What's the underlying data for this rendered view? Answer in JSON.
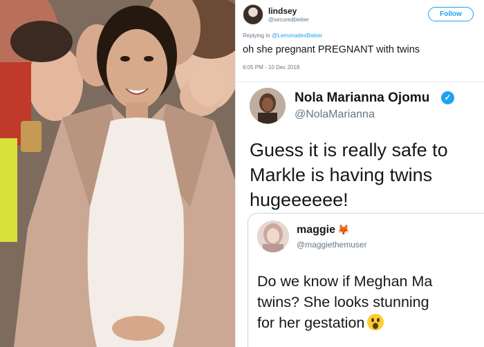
{
  "colors": {
    "twitter_blue": "#1da1f2",
    "text": "#14171a",
    "muted": "#657786",
    "border": "#e6ecf0"
  },
  "tweets": [
    {
      "name": "lindsey",
      "handle": "@securedbieber",
      "follow_label": "Follow",
      "reply_prefix": "Replying to",
      "reply_to": "@LemonadesBieber",
      "text": "oh she pregnant PREGNANT with twins",
      "timestamp": "6:05 PM - 10 Dec 2018"
    },
    {
      "name": "Nola Marianna Ojomu",
      "verified_icon": "verified-badge-icon",
      "handle": "@NolaMarianna",
      "text_lines": [
        "Guess it is really safe to",
        "Markle is having twins",
        "hugeeeeee!"
      ]
    },
    {
      "name": "maggie",
      "name_emoji": "🦊",
      "handle": "@maggiethemuser",
      "text_lines": [
        "Do we know if Meghan Ma",
        "twins? She looks stunning",
        "for her gestation"
      ],
      "trailing_icon": "astonished-face-emoji"
    }
  ]
}
